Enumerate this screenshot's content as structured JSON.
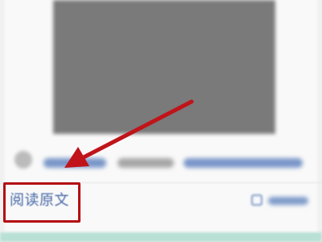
{
  "article": {
    "read_original_label": "阅读原文"
  },
  "annotation": {
    "highlight_color": "#b40e12",
    "arrow_color": "#c0141a"
  },
  "icons": {
    "arrow": "arrow-pointer-icon",
    "avatar": "avatar",
    "right_action": "edit-icon"
  }
}
